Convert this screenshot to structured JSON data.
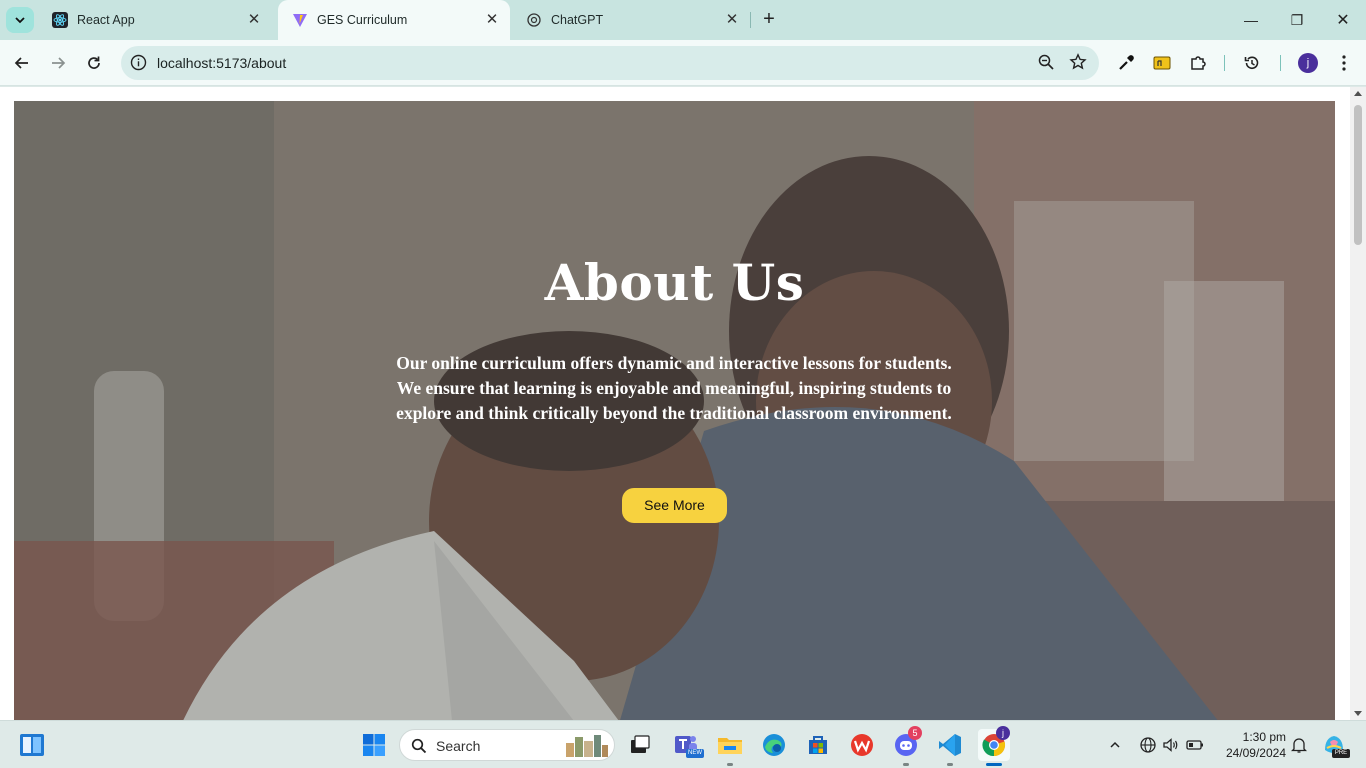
{
  "browser": {
    "tabs": [
      {
        "label": "React App",
        "icon": "react-icon",
        "active": false
      },
      {
        "label": "GES Curriculum",
        "icon": "vite-icon",
        "active": true
      },
      {
        "label": "ChatGPT",
        "icon": "chatgpt-icon",
        "active": false
      }
    ],
    "close_glyph": "✕",
    "new_tab_glyph": "+",
    "window_controls": {
      "minimize": "—",
      "maximize": "❐",
      "close": "✕"
    },
    "url": "localhost:5173/about",
    "profile_initial": "j"
  },
  "page": {
    "hero": {
      "title": "About Us",
      "text": "Our online curriculum offers dynamic and interactive lessons for students. We ensure that learning is enjoyable and meaningful, inspiring students to explore and think critically beyond the traditional classroom environment.",
      "button_label": "See More"
    }
  },
  "taskbar": {
    "search_placeholder": "Search",
    "discord_badge": "5",
    "chrome_badge": "j",
    "wps_badge": "PRE",
    "teams_badge": "NEW",
    "time": "1:30 pm",
    "date": "24/09/2024"
  },
  "colors": {
    "accent_button": "#f7d23f",
    "tabstrip": "#c8e4e0",
    "toolbar": "#f3faf9"
  }
}
